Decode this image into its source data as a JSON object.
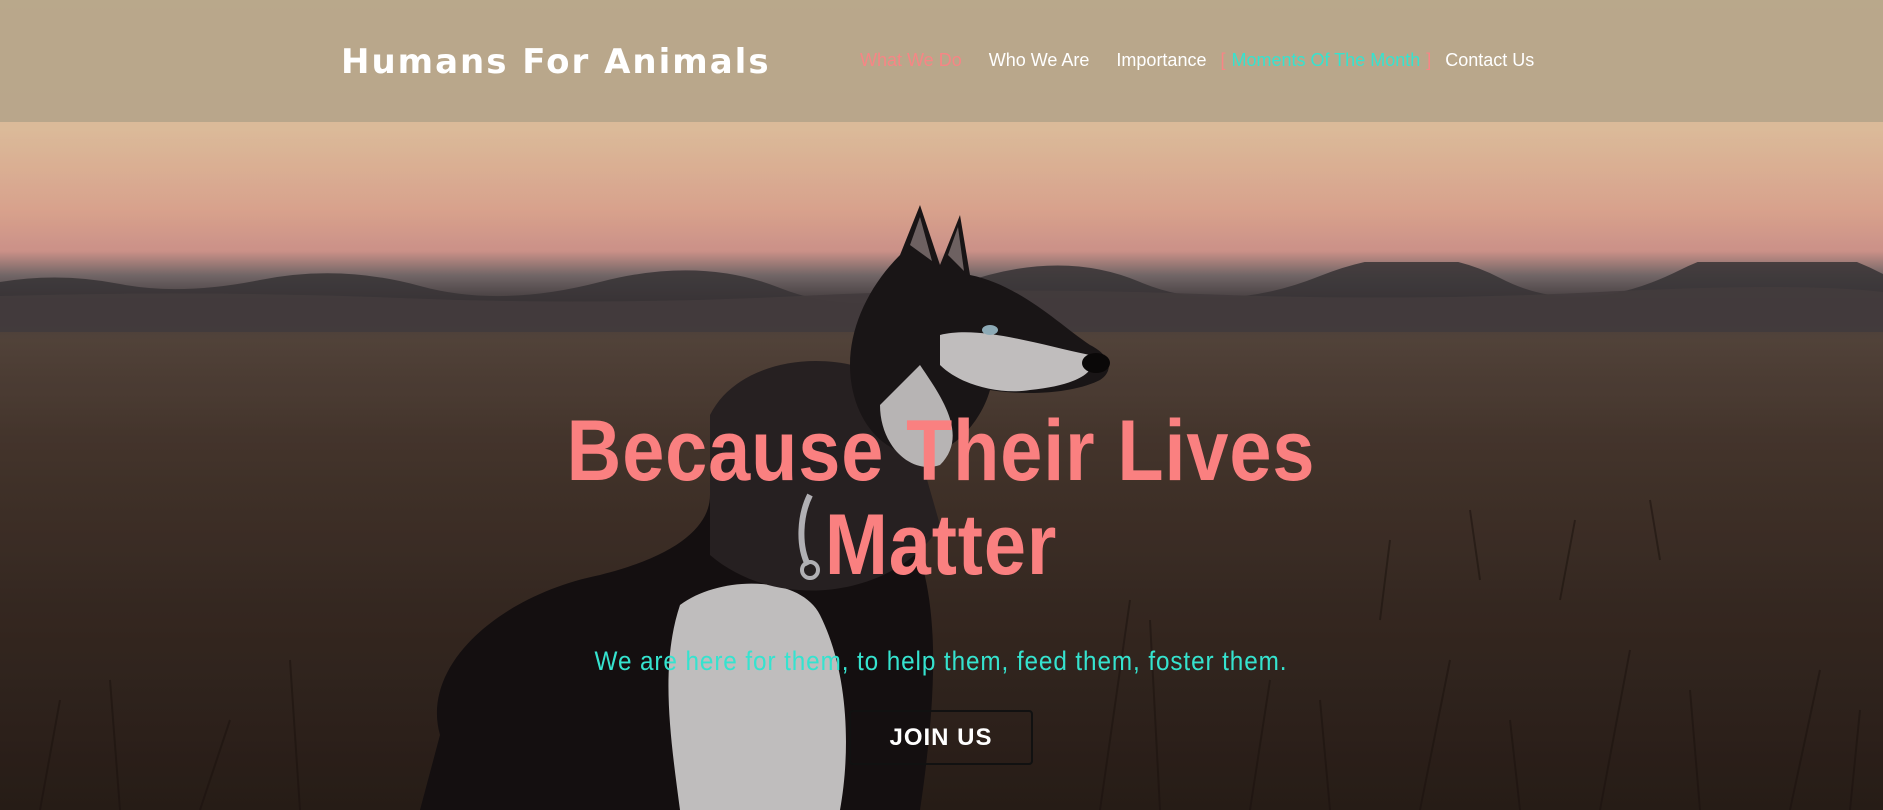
{
  "header": {
    "brand": "Humans For Animals",
    "nav": [
      {
        "label": "What We Do",
        "state": "active"
      },
      {
        "label": "Who We Are",
        "state": "normal"
      },
      {
        "label": "Importance",
        "state": "normal"
      },
      {
        "label": "Moments Of The Month",
        "state": "current"
      },
      {
        "label": "Contact Us",
        "state": "normal"
      }
    ],
    "current_bracket_left": "[",
    "current_bracket_right": "]"
  },
  "hero": {
    "title_line1": "Because Their Lives",
    "title_line2": "Matter",
    "subtitle": "We are here for them, to help them, feed them, foster them.",
    "cta_label": "JOIN US",
    "background_image": "husky-dog-in-field-at-sunset"
  },
  "colors": {
    "accent_red": "#fa8080",
    "accent_teal": "#35e3cf",
    "header_bg": "#afa087",
    "text_white": "#ffffff"
  }
}
